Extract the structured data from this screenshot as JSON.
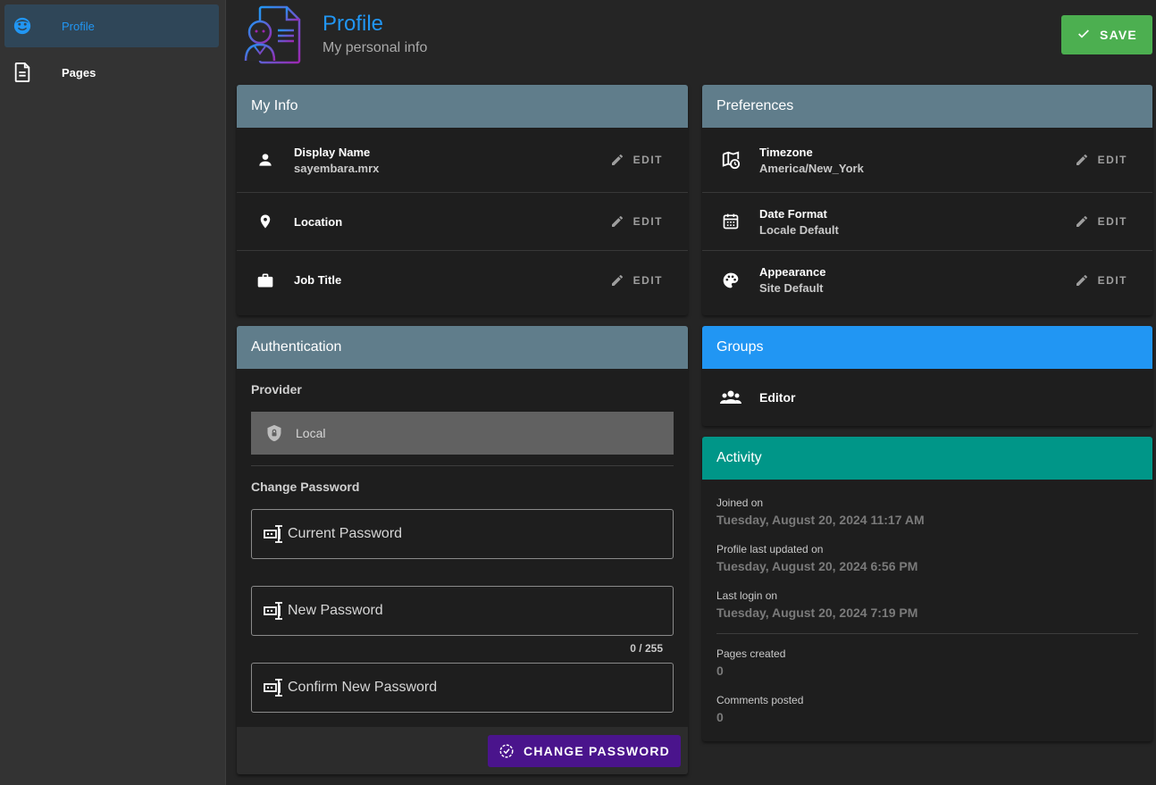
{
  "sidebar": {
    "items": [
      {
        "label": "Profile",
        "icon": "profile-face-icon",
        "active": true
      },
      {
        "label": "Pages",
        "icon": "document-icon",
        "active": false
      }
    ]
  },
  "header": {
    "title": "Profile",
    "subtitle": "My personal info",
    "save_label": "SAVE"
  },
  "my_info": {
    "title": "My Info",
    "edit_label": "EDIT",
    "rows": [
      {
        "label": "Display Name",
        "value": "sayembara.mrx",
        "icon": "person-icon"
      },
      {
        "label": "Location",
        "value": "",
        "icon": "map-marker-icon"
      },
      {
        "label": "Job Title",
        "value": "",
        "icon": "briefcase-icon"
      }
    ]
  },
  "preferences": {
    "title": "Preferences",
    "edit_label": "EDIT",
    "rows": [
      {
        "label": "Timezone",
        "value": "America/New_York",
        "icon": "map-clock-icon"
      },
      {
        "label": "Date Format",
        "value": "Locale Default",
        "icon": "calendar-icon"
      },
      {
        "label": "Appearance",
        "value": "Site Default",
        "icon": "palette-icon"
      }
    ]
  },
  "authentication": {
    "title": "Authentication",
    "provider_label": "Provider",
    "provider_value": "Local",
    "change_password_label": "Change Password",
    "current_password": "Current Password",
    "new_password": "New Password",
    "new_password_counter": "0 / 255",
    "confirm_password": "Confirm New Password",
    "change_button": "CHANGE PASSWORD"
  },
  "groups": {
    "title": "Groups",
    "items": [
      "Editor"
    ]
  },
  "activity": {
    "title": "Activity",
    "joined_label": "Joined on",
    "joined_value": "Tuesday, August 20, 2024 11:17 AM",
    "updated_label": "Profile last updated on",
    "updated_value": "Tuesday, August 20, 2024 6:56 PM",
    "login_label": "Last login on",
    "login_value": "Tuesday, August 20, 2024 7:19 PM",
    "pages_label": "Pages created",
    "pages_value": "0",
    "comments_label": "Comments posted",
    "comments_value": "0"
  },
  "colors": {
    "accent_blue": "#2196f3",
    "save_green": "#4caf50",
    "header_grey": "#607d8b",
    "activity_teal": "#009688",
    "change_pw_purple": "#4a148c"
  }
}
